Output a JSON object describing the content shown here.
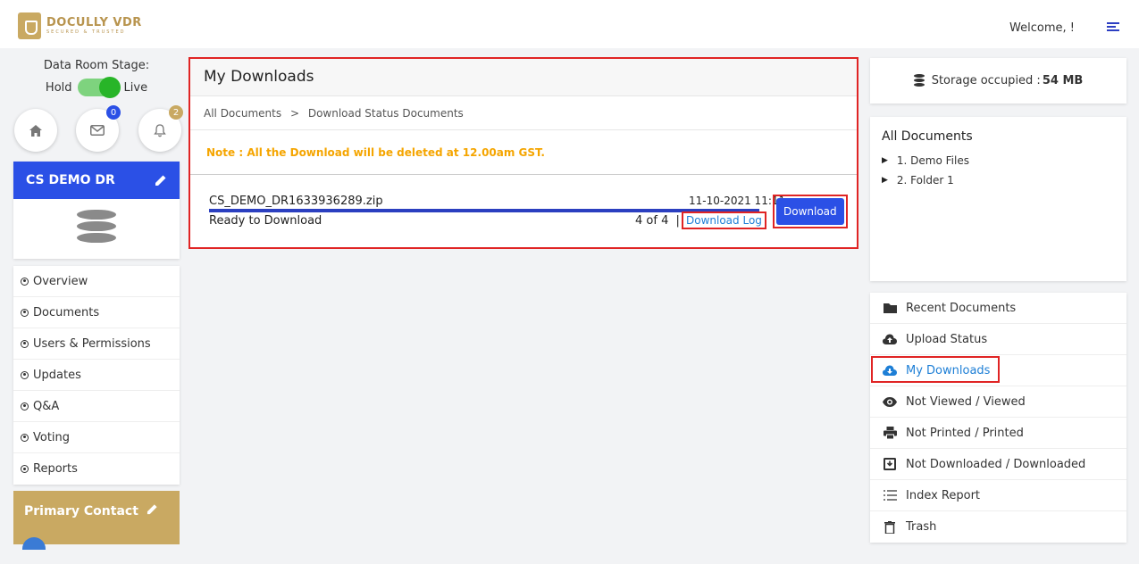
{
  "header": {
    "logo_main": "DOCULLY VDR",
    "logo_tagline": "SECURED & TRUSTED",
    "welcome": "Welcome, !"
  },
  "sidebar": {
    "stage_label": "Data Room Stage:",
    "toggle_off": "Hold",
    "toggle_on": "Live",
    "mail_badge": "0",
    "notify_badge": "2",
    "dataroom_name": "CS DEMO DR",
    "nav": [
      {
        "label": "Overview"
      },
      {
        "label": "Documents"
      },
      {
        "label": "Users & Permissions"
      },
      {
        "label": "Updates"
      },
      {
        "label": "Q&A"
      },
      {
        "label": "Voting"
      },
      {
        "label": "Reports"
      }
    ],
    "primary_contact": "Primary Contact"
  },
  "main": {
    "title": "My Downloads",
    "breadcrumb": [
      "All Documents",
      "Download Status Documents"
    ],
    "breadcrumb_sep": ">",
    "note": "Note : All the Download will be deleted at 12.00am GST.",
    "download": {
      "filename": "CS_DEMO_DR1633936289.zip",
      "date": "11-10-2021 11:11",
      "status": "Ready to Download",
      "count": "4 of 4",
      "sep": "|",
      "log_label": "Download Log",
      "button_label": "Download",
      "progress": 1.0
    }
  },
  "right": {
    "storage_label": "Storage occupied :",
    "storage_value": "54 MB",
    "tree_title": "All Documents",
    "tree_items": [
      {
        "label": "1. Demo Files"
      },
      {
        "label": "2. Folder 1"
      }
    ],
    "menu": [
      {
        "label": "Recent Documents",
        "icon": "folder-icon"
      },
      {
        "label": "Upload Status",
        "icon": "cloud-upload-icon"
      },
      {
        "label": "My Downloads",
        "icon": "cloud-download-icon"
      },
      {
        "label": "Not Viewed / Viewed",
        "icon": "eye-icon"
      },
      {
        "label": "Not Printed / Printed",
        "icon": "printer-icon"
      },
      {
        "label": "Not Downloaded / Downloaded",
        "icon": "download-box-icon"
      },
      {
        "label": "Index Report",
        "icon": "list-icon"
      },
      {
        "label": "Trash",
        "icon": "trash-icon"
      }
    ]
  },
  "colors": {
    "accent": "#2b50e6",
    "gold": "#c9a962",
    "highlight": "#e02424",
    "note": "#f5a500",
    "link": "#1e7fd6"
  }
}
